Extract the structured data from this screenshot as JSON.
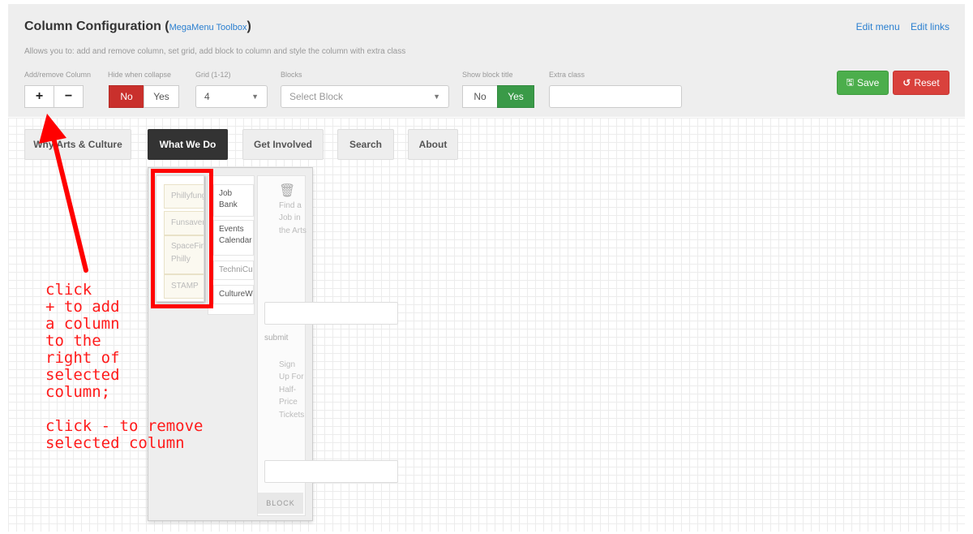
{
  "header": {
    "title": "Column Configuration (",
    "subtitle": "MegaMenu Toolbox",
    "title_close": ")",
    "description": "Allows you to: add and remove column, set grid, add block to column and style the column with extra class"
  },
  "links": {
    "edit_menu": "Edit menu",
    "edit_links": "Edit links"
  },
  "controls": {
    "add_remove_label": "Add/remove Column",
    "add": "+",
    "remove": "−",
    "hide_label": "Hide when collapse",
    "hide_no": "No",
    "hide_yes": "Yes",
    "grid_label": "Grid (1-12)",
    "grid_value": "4",
    "blocks_label": "Blocks",
    "blocks_placeholder": "Select Block",
    "show_title_label": "Show block title",
    "show_no": "No",
    "show_yes": "Yes",
    "extra_label": "Extra class",
    "extra_value": ""
  },
  "actions": {
    "save": "Save",
    "reset": "Reset"
  },
  "nav": [
    {
      "label": "Why Arts & Culture"
    },
    {
      "label": "What We Do"
    },
    {
      "label": "Get Involved"
    },
    {
      "label": "Search"
    },
    {
      "label": "About"
    }
  ],
  "dropdown": {
    "col1": [
      "Phillyfunguide",
      "Funsavers",
      "SpaceFinder Philly",
      "STAMP"
    ],
    "col2": [
      "Job Bank",
      "Events Calendar",
      "TechniCulture",
      "CultureWork"
    ],
    "col3": {
      "find_text": "Find a Job in the Arts",
      "submit": "submit",
      "signup_text": "Sign Up For Half-Price Tickets",
      "block": "BLOCK"
    }
  },
  "annotation": "click\n+ to add\na column\nto the\nright of\nselected\ncolumn;\n\nclick - to remove\nselected column",
  "colors": {
    "accent_red": "#ff0000",
    "save_green": "#3a9a48",
    "reset_red": "#c9302c",
    "active_nav": "#333333"
  }
}
